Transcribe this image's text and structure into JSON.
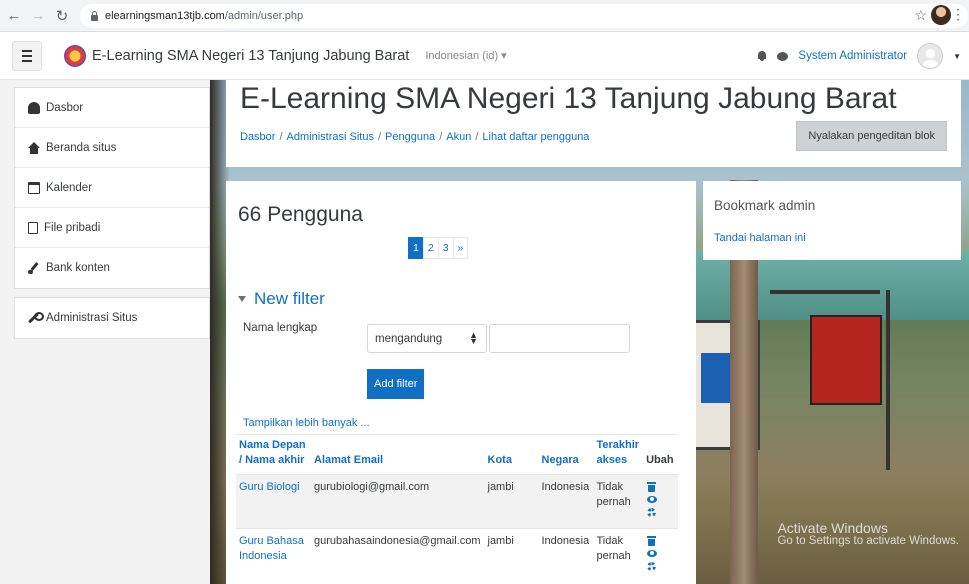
{
  "browser": {
    "url_host": "elearningsman13tjb.com",
    "url_path": "/admin/user.php"
  },
  "navbar": {
    "site_name": "E-Learning SMA Negeri 13 Tanjung Jabung Barat",
    "language": "Indonesian (id) ▾",
    "user_name": "System Administrator"
  },
  "drawer": {
    "items": [
      {
        "label": "Dasbor",
        "icon": "tachometer-icon"
      },
      {
        "label": "Beranda situs",
        "icon": "home-icon"
      },
      {
        "label": "Kalender",
        "icon": "calendar-icon"
      },
      {
        "label": "File pribadi",
        "icon": "file-icon"
      },
      {
        "label": "Bank konten",
        "icon": "brush-icon"
      }
    ],
    "admin_item": {
      "label": "Administrasi Situs",
      "icon": "wrench-icon"
    }
  },
  "header": {
    "title": "E-Learning SMA Negeri 13 Tanjung Jabung Barat",
    "breadcrumb": [
      "Dasbor",
      "Administrasi Situs",
      "Pengguna",
      "Akun",
      "Lihat daftar pengguna"
    ],
    "edit_button": "Nyalakan pengeditan blok"
  },
  "main": {
    "users_count": "66 Pengguna",
    "pages": [
      "1",
      "2",
      "3",
      "»"
    ],
    "active_page": "1",
    "filter": {
      "legend": "New filter",
      "field_label": "Nama lengkap",
      "operator": "mengandung",
      "value": "",
      "add_button": "Add filter",
      "show_more": "Tampilkan lebih banyak ..."
    },
    "table": {
      "headers": {
        "name_line1": "Nama Depan",
        "name_line2": "/ Nama akhir",
        "email": "Alamat Email",
        "city": "Kota",
        "country": "Negara",
        "last_access_line1": "Terakhir",
        "last_access_line2": "akses",
        "edit": "Ubah"
      },
      "rows": [
        {
          "name": "Guru Biologi",
          "email": "gurubiologi@gmail.com",
          "city": "jambi",
          "country": "Indonesia",
          "last_access": "Tidak pernah"
        },
        {
          "name": "Guru Bahasa Indonesia",
          "email": "gurubahasaindonesia@gmail.com",
          "city": "jambi",
          "country": "Indonesia",
          "last_access": "Tidak pernah"
        }
      ]
    }
  },
  "bookmark": {
    "title": "Bookmark admin",
    "link": "Tandai halaman ini"
  },
  "watermark": {
    "line1": "Activate Windows",
    "line2": "Go to Settings to activate Windows."
  },
  "colors": {
    "link": "#0f6fc5",
    "drawer_bg": "#f2f2f2",
    "button_secondary": "#cfd2d4"
  }
}
